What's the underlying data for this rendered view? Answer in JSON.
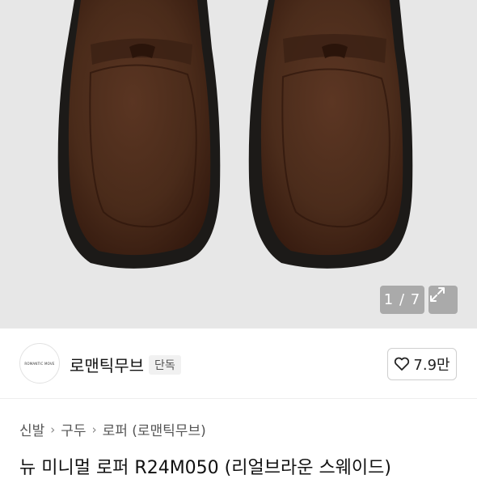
{
  "gallery": {
    "counter": "1 / 7",
    "image_alt": "brown suede penny loafers, top view"
  },
  "shop": {
    "logo_text": "ROMANTIC MOVE",
    "name": "로맨틱무브",
    "badge": "단독",
    "like_count": "7.9만"
  },
  "breadcrumb": {
    "items": [
      "신발",
      "구두",
      "로퍼 (로맨틱무브)"
    ]
  },
  "product": {
    "title": "뉴 미니멀 로퍼 R24M050 (리얼브라운 스웨이드)"
  },
  "colors": {
    "suede": "#4a2b1a",
    "sole": "#1c1a18",
    "background": "#e7e7e7"
  }
}
